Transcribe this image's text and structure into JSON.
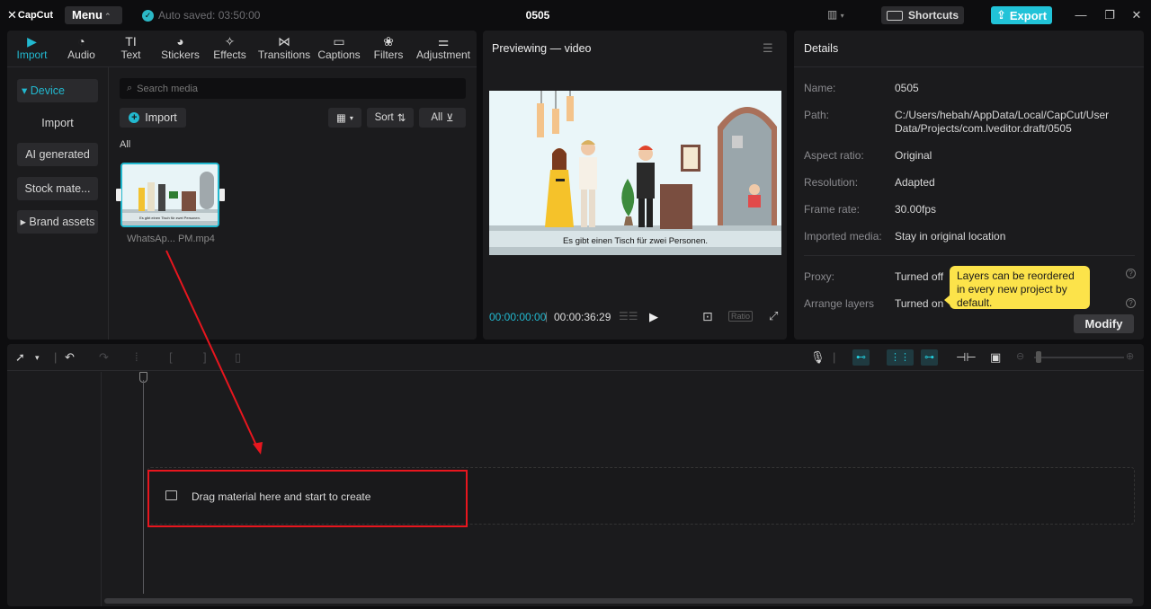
{
  "titlebar": {
    "app_name": "CapCut",
    "menu_label": "Menu",
    "autosave_text": "Auto saved: 03:50:00",
    "project_title": "0505",
    "shortcuts_label": "Shortcuts",
    "export_label": "Export"
  },
  "media": {
    "tabs": [
      {
        "label": "Import",
        "icon": "import-icon",
        "active": true
      },
      {
        "label": "Audio",
        "icon": "audio-icon"
      },
      {
        "label": "Text",
        "icon": "text-icon"
      },
      {
        "label": "Stickers",
        "icon": "stickers-icon"
      },
      {
        "label": "Effects",
        "icon": "effects-icon"
      },
      {
        "label": "Transitions",
        "icon": "transitions-icon"
      },
      {
        "label": "Captions",
        "icon": "captions-icon"
      },
      {
        "label": "Filters",
        "icon": "filters-icon"
      },
      {
        "label": "Adjustment",
        "icon": "adjustment-icon"
      }
    ],
    "side_nav": [
      "Device",
      "Import",
      "AI generated",
      "Stock mate...",
      "Brand assets"
    ],
    "search_placeholder": "Search media",
    "import_button": "Import",
    "sort_label": "Sort",
    "filter_label": "All",
    "section_label": "All",
    "clip_name": "WhatsAp... PM.mp4",
    "thumb_caption": "Es gibt einen Tisch für zwei Personen."
  },
  "preview": {
    "title": "Previewing — video",
    "subtitle": "Es gibt einen Tisch für zwei Personen.",
    "current_time": "00:00:00:00",
    "total_time": "00:00:36:29",
    "ratio_label": "Ratio"
  },
  "details": {
    "title": "Details",
    "rows": [
      {
        "label": "Name:",
        "value": "0505"
      },
      {
        "label": "Path:",
        "value": "C:/Users/hebah/AppData/Local/CapCut/User Data/Projects/com.lveditor.draft/0505"
      },
      {
        "label": "Aspect ratio:",
        "value": "Original"
      },
      {
        "label": "Resolution:",
        "value": "Adapted"
      },
      {
        "label": "Frame rate:",
        "value": "30.00fps"
      },
      {
        "label": "Imported media:",
        "value": "Stay in original location"
      }
    ],
    "proxy_label": "Proxy:",
    "proxy_value": "Turned off",
    "arrange_label": "Arrange layers",
    "arrange_value": "Turned on",
    "tooltip": "Layers can be reordered in every new project by default.",
    "modify_label": "Modify"
  },
  "timeline": {
    "drop_text": "Drag material here and start to create"
  },
  "colors": {
    "accent": "#22b9d0",
    "annotation_red": "#e8161e",
    "tooltip_yellow": "#fce34a"
  }
}
